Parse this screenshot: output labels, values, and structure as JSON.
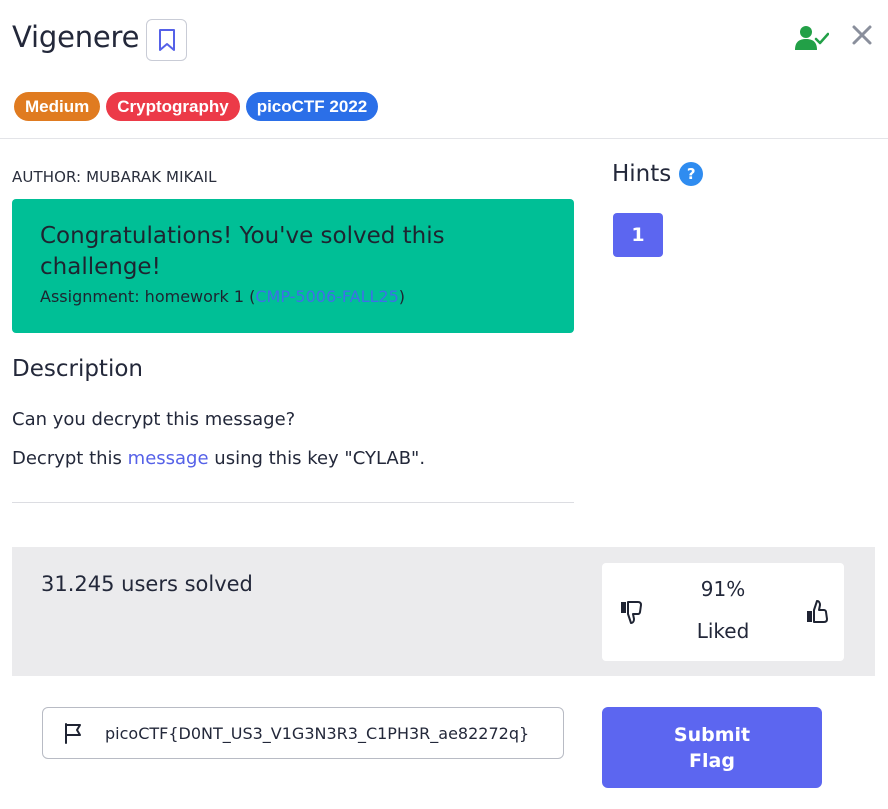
{
  "challenge": {
    "title": "Vigenere",
    "tags": [
      {
        "label": "Medium",
        "color": "#e07b20"
      },
      {
        "label": "Cryptography",
        "color": "#ec3a48"
      },
      {
        "label": "picoCTF 2022",
        "color": "#2b6fe8"
      }
    ],
    "author": "AUTHOR: MUBARAK MIKAIL"
  },
  "status": {
    "solved_icon": "user-check-icon",
    "close_icon": "close-icon",
    "bookmark_icon": "bookmark-icon"
  },
  "congrats": {
    "title": "Congratulations! You've solved this challenge!",
    "assignment_prefix": "Assignment: homework 1 (",
    "assignment_link": "CMP-5006-FALL25",
    "assignment_suffix": ")",
    "background": "#00bf96"
  },
  "hints": {
    "title": "Hints",
    "help_icon": "?",
    "items": [
      "1"
    ]
  },
  "description": {
    "heading": "Description",
    "line1": "Can you decrypt this message?",
    "line2_prefix": "Decrypt this ",
    "line2_link": "message",
    "line2_suffix": " using this key \"CYLAB\"."
  },
  "stats": {
    "solved": "31.245 users solved",
    "liked_percent": "91%",
    "liked_label": "Liked"
  },
  "flag": {
    "value": "picoCTF{D0NT_US3_V1G3N3R3_C1PH3R_ae82272q}",
    "submit_line1": "Submit",
    "submit_line2": "Flag"
  },
  "colors": {
    "accent": "#5c66f0",
    "link": "#5561e8"
  }
}
